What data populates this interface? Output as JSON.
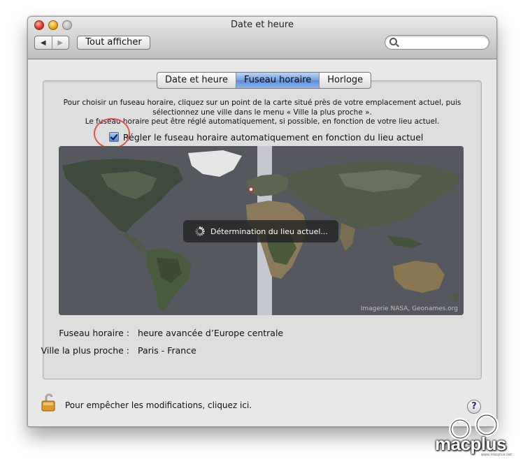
{
  "window": {
    "title": "Date et heure",
    "show_all_label": "Tout afficher",
    "search_placeholder": ""
  },
  "tabs": [
    {
      "label": "Date et heure",
      "active": false
    },
    {
      "label": "Fuseau horaire",
      "active": true
    },
    {
      "label": "Horloge",
      "active": false
    }
  ],
  "timezone": {
    "description": [
      "Pour choisir un fuseau horaire, cliquez sur un point de la carte situé près de votre emplacement actuel, puis",
      "sélectionnez une ville dans le menu « Ville la plus proche ».",
      "Le fuseau horaire peut être réglé automatiquement, si possible, en fonction de votre lieu actuel."
    ],
    "auto_checkbox_label": "Régler le fuseau horaire automatiquement en fonction du lieu actuel",
    "auto_checked": true,
    "hud_label": "Détermination du lieu actuel...",
    "map_credit": "Imagerie NASA, Geonames.org",
    "timezone_key": "Fuseau horaire :",
    "timezone_value": "heure avancée d’Europe centrale",
    "city_key": "Ville la plus proche :",
    "city_value": "Paris - France"
  },
  "footer": {
    "lock_text": "Pour empêcher les modifications, cliquez ici.",
    "help_label": "?"
  },
  "watermark": {
    "brand": "macplus",
    "small": "www.macplus.net"
  },
  "colors": {
    "accent": "#5a8bd6",
    "highlight_circle": "#e2524a",
    "map_ocean": "#4e5157"
  }
}
